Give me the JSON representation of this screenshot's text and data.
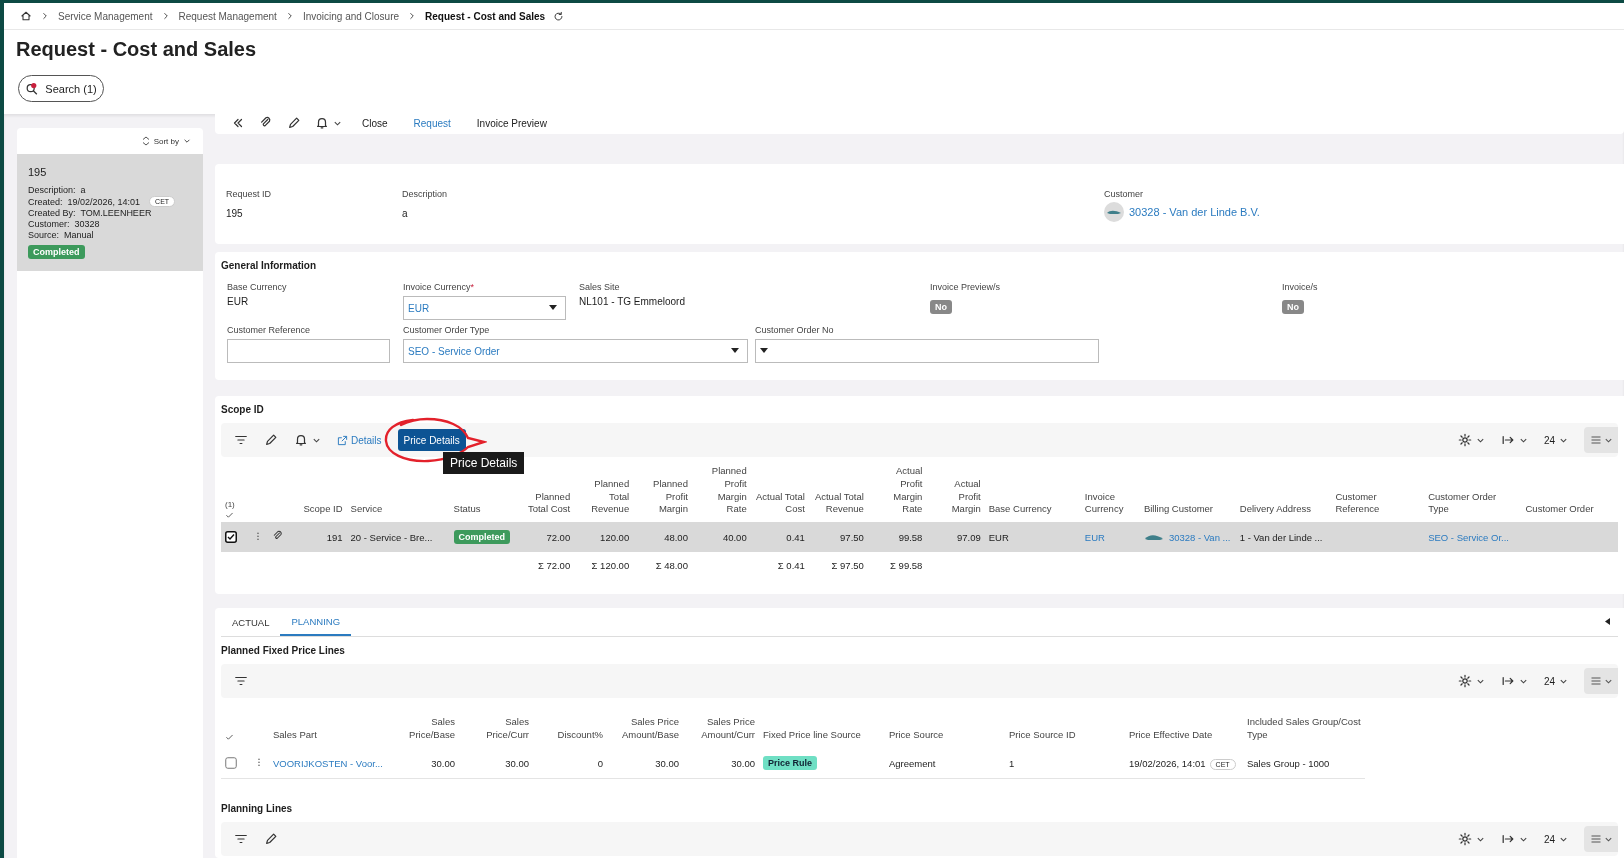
{
  "breadcrumb": {
    "items": [
      "Service Management",
      "Request Management",
      "Invoicing and Closure"
    ],
    "current": "Request - Cost and Sales"
  },
  "title": "Request - Cost and Sales",
  "search_button": "Search (1)",
  "record_toolbar": [
    {
      "label": "Close",
      "selected": false
    },
    {
      "label": "Request",
      "selected": true
    },
    {
      "label": "Invoice Preview",
      "selected": false
    }
  ],
  "record_list": {
    "sort_label": "Sort by",
    "items": [
      {
        "id": "195",
        "selected": true,
        "fields": [
          {
            "label": "Description:",
            "value": "a"
          },
          {
            "label": "Created:",
            "value": "19/02/2026, 14:01",
            "badge": "CET"
          },
          {
            "label": "Created By:",
            "value": "TOM.LEENHEER"
          },
          {
            "label": "Customer:",
            "value": "30328"
          },
          {
            "label": "Source:",
            "value": "Manual"
          }
        ],
        "status": "Completed"
      }
    ]
  },
  "header": [
    {
      "label": "Request ID",
      "value": "195",
      "kind": "text"
    },
    {
      "label": "Description",
      "value": "a",
      "kind": "text"
    },
    {
      "label": "Customer",
      "value": "30328 - Van der Linde B.V.",
      "kind": "customer"
    }
  ],
  "general_information": {
    "title": "General Information",
    "rows": [
      [
        {
          "label": "Base Currency",
          "value": "EUR",
          "kind": "text"
        },
        {
          "label": "Invoice Currency",
          "required_mark": "*",
          "value": "EUR",
          "kind": "select"
        },
        {
          "label": "Sales Site",
          "value": "NL101 - TG Emmeloord",
          "kind": "text"
        },
        {
          "label": "Invoice Preview/s",
          "value": "No",
          "kind": "flag"
        },
        {
          "label": "Invoice/s",
          "value": "No",
          "kind": "flag"
        }
      ],
      [
        {
          "label": "Customer Reference",
          "kind": "input"
        },
        {
          "label": "Customer Order Type",
          "value": "SEO - Service Order",
          "kind": "select"
        },
        {
          "label": "Customer Order No",
          "kind": "select"
        }
      ]
    ]
  },
  "scope": {
    "title": "Scope ID",
    "toolbar": {
      "link": "Details",
      "primary_button": "Price Details",
      "page_size": "24"
    },
    "tooltip": "Price Details",
    "selection_count": "(1)",
    "columns": [
      {
        "label": "Scope ID",
        "kind": "number"
      },
      {
        "label": "Service",
        "kind": "text"
      },
      {
        "label": "Status",
        "kind": "status"
      },
      {
        "label": "Planned Total Cost",
        "kind": "number",
        "total": "Σ 72.00"
      },
      {
        "label": "Planned Total Revenue",
        "kind": "number",
        "total": "Σ 120.00"
      },
      {
        "label": "Planned Profit Margin",
        "kind": "number",
        "total": "Σ 48.00"
      },
      {
        "label": "Planned Profit Margin Rate",
        "kind": "number"
      },
      {
        "label": "Actual Total Cost",
        "kind": "number",
        "total": "Σ 0.41"
      },
      {
        "label": "Actual Total Revenue",
        "kind": "number",
        "total": "Σ 97.50"
      },
      {
        "label": "Actual Profit Margin Rate",
        "kind": "number",
        "total": "Σ 99.58"
      },
      {
        "label": "Actual Profit Margin",
        "kind": "number"
      },
      {
        "label": "Base Currency",
        "kind": "text"
      },
      {
        "label": "Invoice Currency",
        "kind": "link"
      },
      {
        "label": "Billing Customer",
        "kind": "customer"
      },
      {
        "label": "Delivery Address",
        "kind": "text"
      },
      {
        "label": "Customer Reference",
        "kind": "text"
      },
      {
        "label": "Customer Order Type",
        "kind": "link"
      },
      {
        "label": "Customer Order",
        "kind": "text"
      }
    ],
    "rows": [
      {
        "selected": true,
        "cells": [
          "191",
          "20 - Service - Bre...",
          "Completed",
          "72.00",
          "120.00",
          "48.00",
          "40.00",
          "0.41",
          "97.50",
          "99.58",
          "97.09",
          "EUR",
          "EUR",
          "30328 - Van ...",
          "1 - Van der Linde ...",
          null,
          "SEO - Service Or...",
          null
        ]
      }
    ]
  },
  "tabs": [
    {
      "label": "ACTUAL",
      "selected": false
    },
    {
      "label": "PLANNING",
      "selected": true
    }
  ],
  "fixed_price_lines": {
    "title": "Planned Fixed Price Lines",
    "page_size": "24",
    "columns": [
      {
        "label": "Sales Part",
        "kind": "link"
      },
      {
        "label": "Sales Price/Base",
        "kind": "number"
      },
      {
        "label": "Sales Price/Curr",
        "kind": "number"
      },
      {
        "label": "Discount%",
        "kind": "number"
      },
      {
        "label": "Sales Price Amount/Base",
        "kind": "number"
      },
      {
        "label": "Sales Price Amount/Curr",
        "kind": "number"
      },
      {
        "label": "Fixed Price line Source",
        "kind": "tag"
      },
      {
        "label": "Price Source",
        "kind": "text"
      },
      {
        "label": "Price Source ID",
        "kind": "text"
      },
      {
        "label": "Price Effective Date",
        "kind": "date"
      },
      {
        "label": "Included Sales Group/Cost Type",
        "kind": "text"
      }
    ],
    "rows": [
      {
        "selected": false,
        "date_badge": "CET",
        "cells": [
          "VOORIJKOSTEN - Voor...",
          "30.00",
          "30.00",
          "0",
          "30.00",
          "30.00",
          "Price Rule",
          "Agreement",
          "1",
          "19/02/2026, 14:01",
          "Sales Group - 1000"
        ]
      }
    ]
  },
  "planning_lines": {
    "title": "Planning Lines",
    "page_size": "24"
  }
}
